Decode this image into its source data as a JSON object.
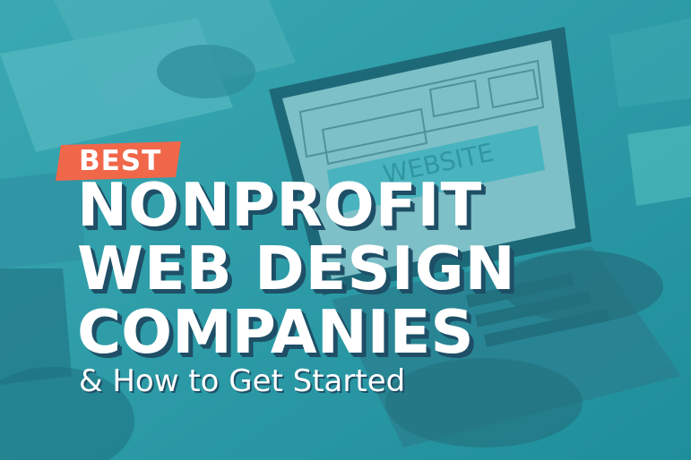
{
  "headline": {
    "badge": "BEST",
    "line1": "NONPROFIT",
    "line2": "WEB DESIGN",
    "line3": "COMPANIES",
    "subtitle": "& How to Get Started"
  },
  "colors": {
    "overlay": "#2a9aa6",
    "badge": "#f0674a",
    "text": "#ffffff",
    "shadow": "#1e4f66"
  }
}
